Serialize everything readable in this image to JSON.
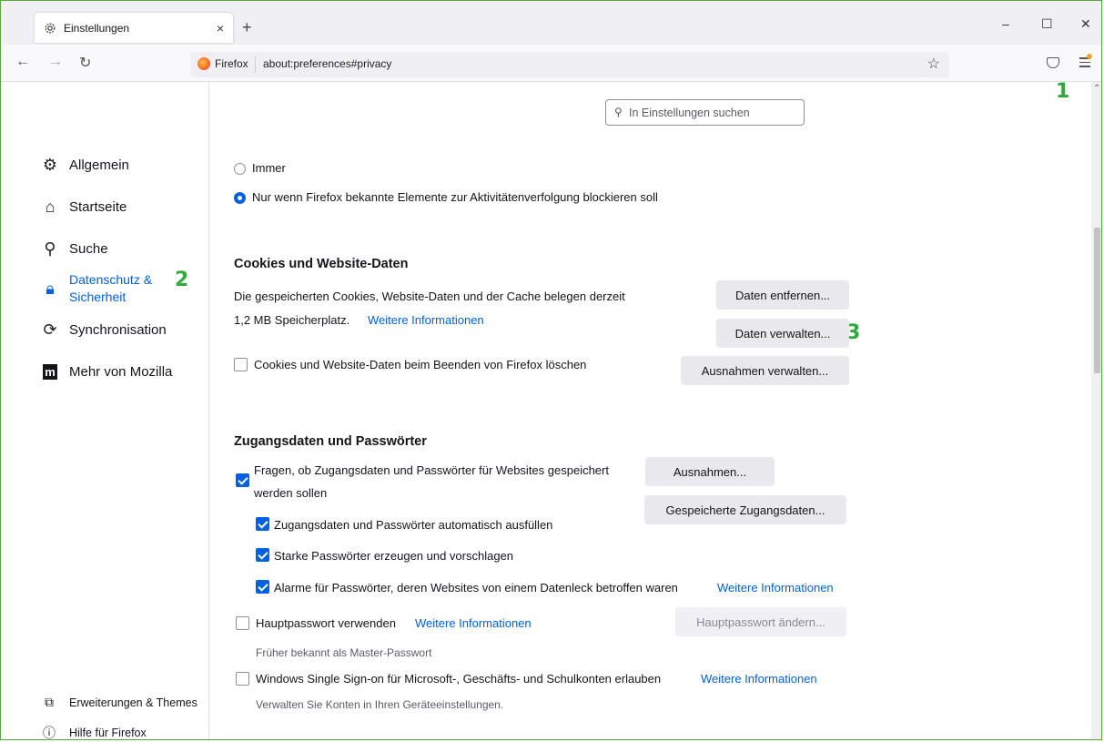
{
  "window": {
    "tab_title": "Einstellungen",
    "tab_close": "×",
    "new_tab": "+",
    "minimize": "–",
    "maximize": "☐",
    "close": "✕"
  },
  "navbar": {
    "back": "←",
    "forward": "→",
    "reload": "↻",
    "identity_label": "Firefox",
    "url": "about:preferences#privacy",
    "bookmark_star": "☆"
  },
  "annotations": [
    "1",
    "2",
    "3"
  ],
  "search": {
    "placeholder": "In Einstellungen suchen",
    "icon": "search-icon"
  },
  "sidebar": {
    "items": [
      {
        "label": "Allgemein",
        "icon": "gear-icon"
      },
      {
        "label": "Startseite",
        "icon": "home-icon"
      },
      {
        "label": "Suche",
        "icon": "search-icon"
      },
      {
        "label": "Datenschutz &",
        "label2": "Sicherheit",
        "icon": "lock-icon",
        "active": true
      },
      {
        "label": "Synchronisation",
        "icon": "sync-icon"
      },
      {
        "label": "Mehr von Mozilla",
        "icon": "mozilla-icon"
      }
    ],
    "footer": [
      {
        "label": "Erweiterungen & Themes",
        "icon": "puzzle-icon"
      },
      {
        "label": "Hilfe für Firefox",
        "icon": "help-icon"
      }
    ]
  },
  "dnt": {
    "always": "Immer",
    "only_when": "Nur wenn Firefox bekannte Elemente zur Aktivitätenverfolgung blockieren soll",
    "selected": "only_when"
  },
  "cookies": {
    "heading": "Cookies und Website-Daten",
    "line1": "Die gespeicherten Cookies, Website-Daten und der Cache belegen derzeit",
    "line2": "1,2 MB Speicherplatz.",
    "more_info": "Weitere Informationen",
    "clear_btn": "Daten entfernen...",
    "manage_btn": "Daten verwalten...",
    "delete_on_close": "Cookies und Website-Daten beim Beenden von Firefox löschen",
    "delete_on_close_checked": false,
    "exceptions_btn": "Ausnahmen verwalten..."
  },
  "logins": {
    "heading": "Zugangsdaten und Passwörter",
    "ask_line1": "Fragen, ob Zugangsdaten und Passwörter für Websites gespeichert",
    "ask_line2": "werden sollen",
    "ask_checked": true,
    "exceptions_btn": "Ausnahmen...",
    "saved_btn": "Gespeicherte Zugangsdaten...",
    "autofill": "Zugangsdaten und Passwörter automatisch ausfüllen",
    "autofill_checked": true,
    "strong": "Starke Passwörter erzeugen und vorschlagen",
    "strong_checked": true,
    "breach": "Alarme für Passwörter, deren Websites von einem Datenleck betroffen waren",
    "breach_checked": true,
    "breach_more": "Weitere Informationen",
    "primary": "Hauptpasswort verwenden",
    "primary_checked": false,
    "primary_more": "Weitere Informationen",
    "primary_change_btn": "Hauptpasswort ändern...",
    "primary_note": "Früher bekannt als Master-Passwort",
    "sso": "Windows Single Sign-on für Microsoft-, Geschäfts- und Schulkonten erlauben",
    "sso_checked": false,
    "sso_more": "Weitere Informationen",
    "sso_note": "Verwalten Sie Konten in Ihren Geräteeinstellungen."
  },
  "colors": {
    "accent": "#0061e0",
    "annotation": "#2eab3c"
  }
}
